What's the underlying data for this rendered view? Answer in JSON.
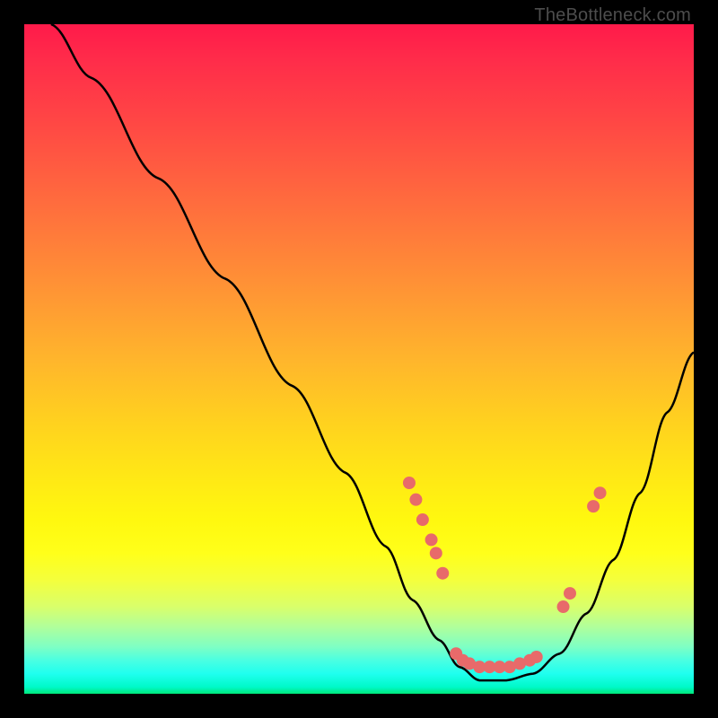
{
  "watermark": "TheBottleneck.com",
  "chart_data": {
    "type": "line",
    "title": "",
    "xlabel": "",
    "ylabel": "",
    "xlim": [
      0,
      100
    ],
    "ylim": [
      0,
      100
    ],
    "curve": [
      {
        "x": 4,
        "y": 100
      },
      {
        "x": 10,
        "y": 92
      },
      {
        "x": 20,
        "y": 77
      },
      {
        "x": 30,
        "y": 62
      },
      {
        "x": 40,
        "y": 46
      },
      {
        "x": 48,
        "y": 33
      },
      {
        "x": 54,
        "y": 22
      },
      {
        "x": 58,
        "y": 14
      },
      {
        "x": 62,
        "y": 8
      },
      {
        "x": 65,
        "y": 4
      },
      {
        "x": 68,
        "y": 2
      },
      {
        "x": 72,
        "y": 2
      },
      {
        "x": 76,
        "y": 3
      },
      {
        "x": 80,
        "y": 6
      },
      {
        "x": 84,
        "y": 12
      },
      {
        "x": 88,
        "y": 20
      },
      {
        "x": 92,
        "y": 30
      },
      {
        "x": 96,
        "y": 42
      },
      {
        "x": 100,
        "y": 51
      }
    ],
    "markers": [
      {
        "x": 57.5,
        "y": 31.5
      },
      {
        "x": 58.5,
        "y": 29
      },
      {
        "x": 59.5,
        "y": 26
      },
      {
        "x": 60.8,
        "y": 23
      },
      {
        "x": 61.5,
        "y": 21
      },
      {
        "x": 62.5,
        "y": 18
      },
      {
        "x": 64.5,
        "y": 6
      },
      {
        "x": 65.5,
        "y": 5
      },
      {
        "x": 66.5,
        "y": 4.5
      },
      {
        "x": 68,
        "y": 4
      },
      {
        "x": 69.5,
        "y": 4
      },
      {
        "x": 71,
        "y": 4
      },
      {
        "x": 72.5,
        "y": 4
      },
      {
        "x": 74,
        "y": 4.5
      },
      {
        "x": 75.5,
        "y": 5
      },
      {
        "x": 76.5,
        "y": 5.5
      },
      {
        "x": 80.5,
        "y": 13
      },
      {
        "x": 81.5,
        "y": 15
      },
      {
        "x": 85,
        "y": 28
      },
      {
        "x": 86,
        "y": 30
      }
    ],
    "marker_color": "#e86a6a",
    "curve_color": "#000000"
  }
}
